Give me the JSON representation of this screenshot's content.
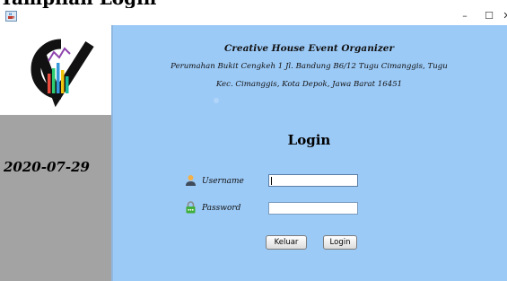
{
  "page_heading": "Tampilan Login",
  "window": {
    "minimize_glyph": "–",
    "maximize_glyph": "☐",
    "close_glyph": "✕"
  },
  "sidebar": {
    "date": "2020-07-29"
  },
  "header": {
    "organization": "Creative House Event Organizer",
    "address_line1": "Perumahan Bukit Cengkeh 1 Jl. Bandung B6/12 Tugu Cimanggis, Tugu",
    "address_line2": "Kec. Cimanggis, Kota Depok, Jawa Barat 16451"
  },
  "login": {
    "title": "Login",
    "username_label": "Username",
    "password_label": "Password",
    "username_value": "",
    "password_value": "",
    "keluar_label": "Keluar",
    "login_label": "Login"
  },
  "colors": {
    "main_background": "#9ccaf7",
    "sidebar_background": "#a3a3a3"
  },
  "icons": {
    "app": "java-cup-icon",
    "logo": "cv-logo",
    "user": "user-icon",
    "password": "lock-icon"
  }
}
